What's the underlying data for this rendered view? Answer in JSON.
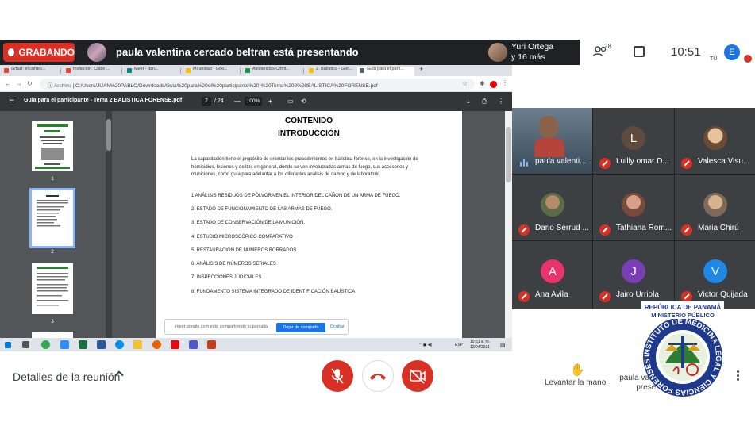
{
  "meet": {
    "recording_label": "GRABANDO",
    "presenter_text": "paula valentina cercado beltran está presentando",
    "pinned_name": "Yuri Ortega",
    "more_count": "y 16 más",
    "people_count": "28",
    "time": "10:51",
    "you_label": "TÚ",
    "you_initial": "E"
  },
  "browser": {
    "tabs": [
      {
        "label": "Gmail: el correo...",
        "color": "#ea4335"
      },
      {
        "label": "Invitación: Clase ...",
        "color": "#ea4335"
      },
      {
        "label": "Meet - dzn...",
        "color": "#00897b"
      },
      {
        "label": "Mi unidad - Goo...",
        "color": "#fbbc04"
      },
      {
        "label": "Asistencias Crimi...",
        "color": "#0f9d58"
      },
      {
        "label": "2. Balística - Goo...",
        "color": "#fbbc04"
      },
      {
        "label": "Guia para el parti...",
        "color": "#5f6368"
      }
    ],
    "new_tab": "+",
    "url_scheme": "Archivo",
    "url": "C:/Users/JUAN%20PABLO/Downloads/Guia%20para%20el%20participante%20-%20Tema%202%20BALISTICA%20FORENSE.pdf"
  },
  "pdf": {
    "title": "Guia para el participante - Tema 2 BALISTICA FORENSE.pdf",
    "current_page": "2",
    "total_pages": "/ 24",
    "zoom": "100%",
    "thumb_numbers": [
      "1",
      "2",
      "3"
    ],
    "heading1": "CONTENIDO",
    "heading2": "INTRODUCCIÓN",
    "intro": "La capacitación tiene el propósito de orientar los procedimientos en balística forense, en la investigación de homicidios, lesiones y delitos en general, donde se ven involucradas armas de fuego, sus accesorios y municiones, como guía para adelantar a los diferentes análisis de campo y de laboratorio.",
    "items": [
      "1 ANÁLISIS RESIDUOS DE PÓLVORA EN EL INTERIOR DEL CAÑÓN DE UN ARMA DE FUEGO.",
      "2. ESTADO DE FUNCIONAMIENTO DE LAS ARMAS DE FUEGO.",
      "3. ESTADO DE CONSERVACIÓN DE LA MUNICIÓN.",
      "4. ESTUDIO MICROSCÓPICO COMPARATIVO",
      "5. RESTAURACIÓN DE NÚMEROS BORRADOS",
      "6. ANÁLISIS DE NÚMEROS SERIALES",
      "7. INSPECCIONES JUDICIALES",
      "8. FUNDAMENTO SISTEMA INTEGRADO DE IDENTIFICACIÓN BALÍSTICA"
    ]
  },
  "share_notice": {
    "text": "meet.google.com está compartiendo tu pantalla.",
    "stop": "Dejar de compartir",
    "hide": "Ocultar"
  },
  "taskbar": {
    "lang": "ESP",
    "time": "10:51 a. m.",
    "date": "12/04/2021"
  },
  "participants": [
    {
      "name": "paula valenti...",
      "initial": "",
      "color": "#5b7a92",
      "speaking": true
    },
    {
      "name": "Luilly omar D...",
      "initial": "L",
      "color": "#5f4b3e",
      "speaking": false
    },
    {
      "name": "Valesca Visu...",
      "initial": "",
      "color": "#c79a6d",
      "speaking": false
    },
    {
      "name": "Dario Serrud ...",
      "initial": "",
      "color": "#6a7a5a",
      "speaking": false
    },
    {
      "name": "Tathiana Rom...",
      "initial": "",
      "color": "#b07a6a",
      "speaking": false
    },
    {
      "name": "Maria Chirú",
      "initial": "",
      "color": "#8a7a6a",
      "speaking": false
    },
    {
      "name": "Ana Avila",
      "initial": "A",
      "color": "#e8336d",
      "speaking": false
    },
    {
      "name": "Jairo Urriola",
      "initial": "J",
      "color": "#7b3fb5",
      "speaking": false
    },
    {
      "name": "Victor Quijada",
      "initial": "V",
      "color": "#1e88e5",
      "speaking": false
    }
  ],
  "logo": {
    "line1": "REPÚBLICA DE PANAMÁ",
    "line2": "MINISTERIO PÚBLICO",
    "ring": "INSTITUTO DE MEDICINA LEGAL Y CIENCIAS FORENSES"
  },
  "controls": {
    "details": "Detalles de la reunión",
    "raise_hand": "Levantar la mano",
    "presenting": "paula vale... está prese..."
  }
}
